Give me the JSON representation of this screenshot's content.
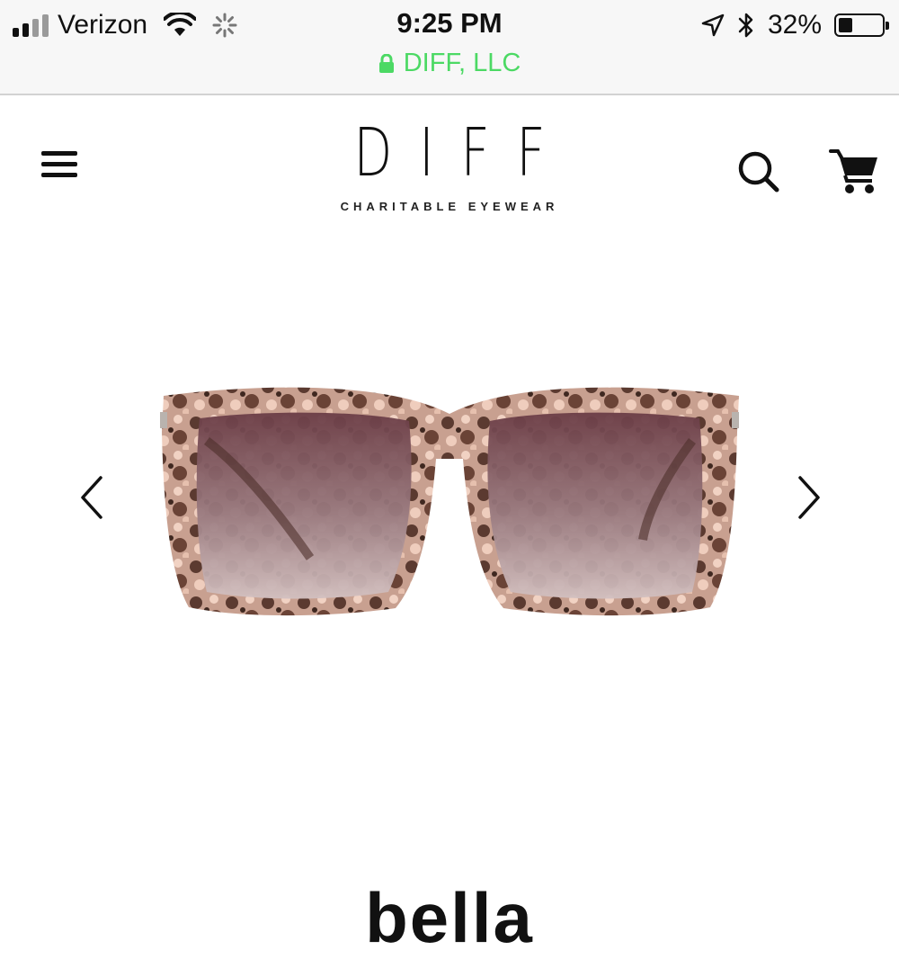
{
  "status_bar": {
    "carrier": "Verizon",
    "time": "9:25 PM",
    "site_identity": "DIFF, LLC",
    "battery_percent_text": "32%",
    "battery_level": 0.32,
    "icons": [
      "signal-bars-icon",
      "wifi-icon",
      "loading-spinner-icon",
      "lock-icon",
      "location-arrow-icon",
      "bluetooth-icon",
      "battery-icon"
    ],
    "url_color": "#4cd964"
  },
  "header": {
    "brand": "DIFF",
    "tagline": "CHARITABLE EYEWEAR",
    "icons": [
      "hamburger-menu-icon",
      "search-icon",
      "shopping-cart-icon"
    ]
  },
  "carousel": {
    "image_subject": "tortoise sunglasses",
    "icons": [
      "chevron-left-icon",
      "chevron-right-icon"
    ]
  },
  "product": {
    "title": "bella"
  }
}
